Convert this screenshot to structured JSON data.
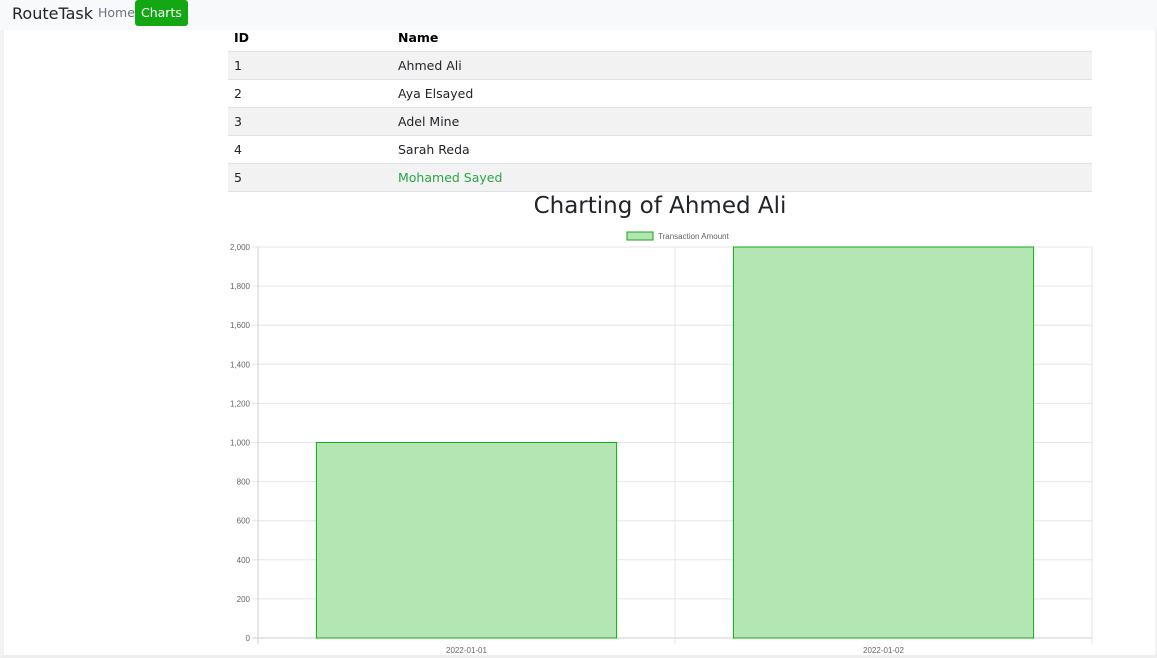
{
  "app": {
    "brand": "RouteTask",
    "nav": [
      {
        "label": "Home",
        "active": false
      },
      {
        "label": "Charts",
        "active": true
      }
    ],
    "accent_color": "#14a714"
  },
  "table": {
    "headers": [
      "ID",
      "Name"
    ],
    "rows": [
      {
        "id": "1",
        "name": "Ahmed Ali"
      },
      {
        "id": "2",
        "name": "Aya Elsayed"
      },
      {
        "id": "3",
        "name": "Adel Mine"
      },
      {
        "id": "4",
        "name": "Sarah Reda"
      },
      {
        "id": "5",
        "name": "Mohamed Sayed"
      }
    ]
  },
  "chart_data": {
    "type": "bar",
    "title": "Charting of Ahmed Ali",
    "categories": [
      "2022-01-01",
      "2022-01-02"
    ],
    "series": [
      {
        "name": "Transaction Amount",
        "values": [
          1000,
          2000
        ]
      }
    ],
    "ylim": [
      0,
      2000
    ],
    "yticks": [
      "0",
      "200",
      "400",
      "600",
      "800",
      "1,000",
      "1,200",
      "1,400",
      "1,600",
      "1,800",
      "2,000"
    ],
    "legend_position": "top-center",
    "grid": true,
    "bar_fill": "#b4e6b4",
    "bar_border": "#14a714"
  }
}
